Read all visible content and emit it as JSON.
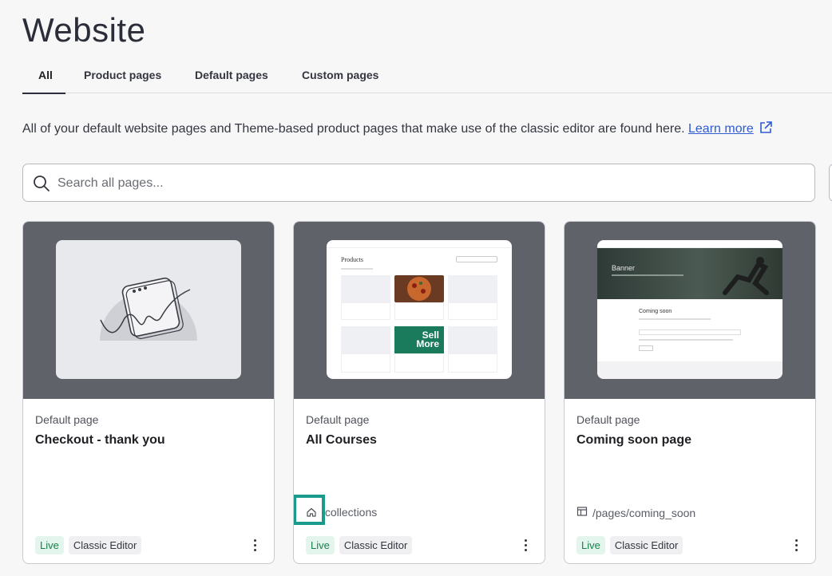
{
  "header": {
    "title": "Website"
  },
  "tabs": [
    {
      "label": "All",
      "active": true
    },
    {
      "label": "Product pages",
      "active": false
    },
    {
      "label": "Default pages",
      "active": false
    },
    {
      "label": "Custom pages",
      "active": false
    }
  ],
  "intro": {
    "text": "All of your default website pages and Theme-based product pages that make use of the classic editor are found here.",
    "link_label": "Learn more"
  },
  "search": {
    "placeholder": "Search all pages...",
    "value": ""
  },
  "cards": [
    {
      "type": "Default page",
      "title": "Checkout - thank you",
      "path": "",
      "badges": [
        "Live",
        "Classic Editor"
      ]
    },
    {
      "type": "Default page",
      "title": "All Courses",
      "path": "/collections",
      "path_icon": "home-icon",
      "badges": [
        "Live",
        "Classic Editor"
      ],
      "preview": {
        "heading": "Products",
        "promo_line1": "Sell",
        "promo_line2": "More"
      }
    },
    {
      "type": "Default page",
      "title": "Coming soon page",
      "path": "/pages/coming_soon",
      "path_icon": "page-layout-icon",
      "badges": [
        "Live",
        "Classic Editor"
      ],
      "preview": {
        "banner": "Banner",
        "heading": "Coming soon"
      }
    }
  ],
  "colors": {
    "thumb_bg": "#5f6268",
    "live_badge": "#1b7f4b",
    "link": "#2f5bd3",
    "highlight": "#1a9a8a"
  }
}
